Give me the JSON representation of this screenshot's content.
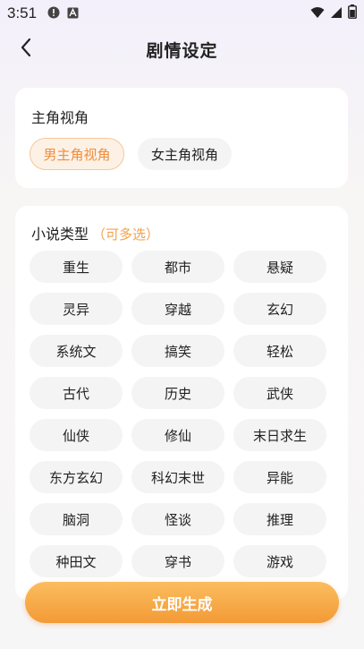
{
  "status_bar": {
    "time": "3:51",
    "left_icons": [
      "alert-icon",
      "font-a-icon"
    ],
    "right_icons": [
      "wifi-icon",
      "signal-icon",
      "battery-icon"
    ]
  },
  "header": {
    "title": "剧情设定",
    "back_icon": "chevron-left-icon"
  },
  "pov_section": {
    "label": "主角视角",
    "options": [
      {
        "label": "男主角视角",
        "selected": true
      },
      {
        "label": "女主角视角",
        "selected": false
      }
    ]
  },
  "genre_section": {
    "label": "小说类型",
    "hint": "（可多选）",
    "genres": [
      "重生",
      "都市",
      "悬疑",
      "灵异",
      "穿越",
      "玄幻",
      "系统文",
      "搞笑",
      "轻松",
      "古代",
      "历史",
      "武侠",
      "仙侠",
      "修仙",
      "末日求生",
      "东方玄幻",
      "科幻末世",
      "异能",
      "脑洞",
      "怪谈",
      "推理",
      "种田文",
      "穿书",
      "游戏"
    ]
  },
  "generate_button": {
    "label": "立即生成"
  },
  "colors": {
    "accent": "#f39a36",
    "selected_text": "#ee8e3b",
    "chip_bg": "#f4f4f4"
  }
}
